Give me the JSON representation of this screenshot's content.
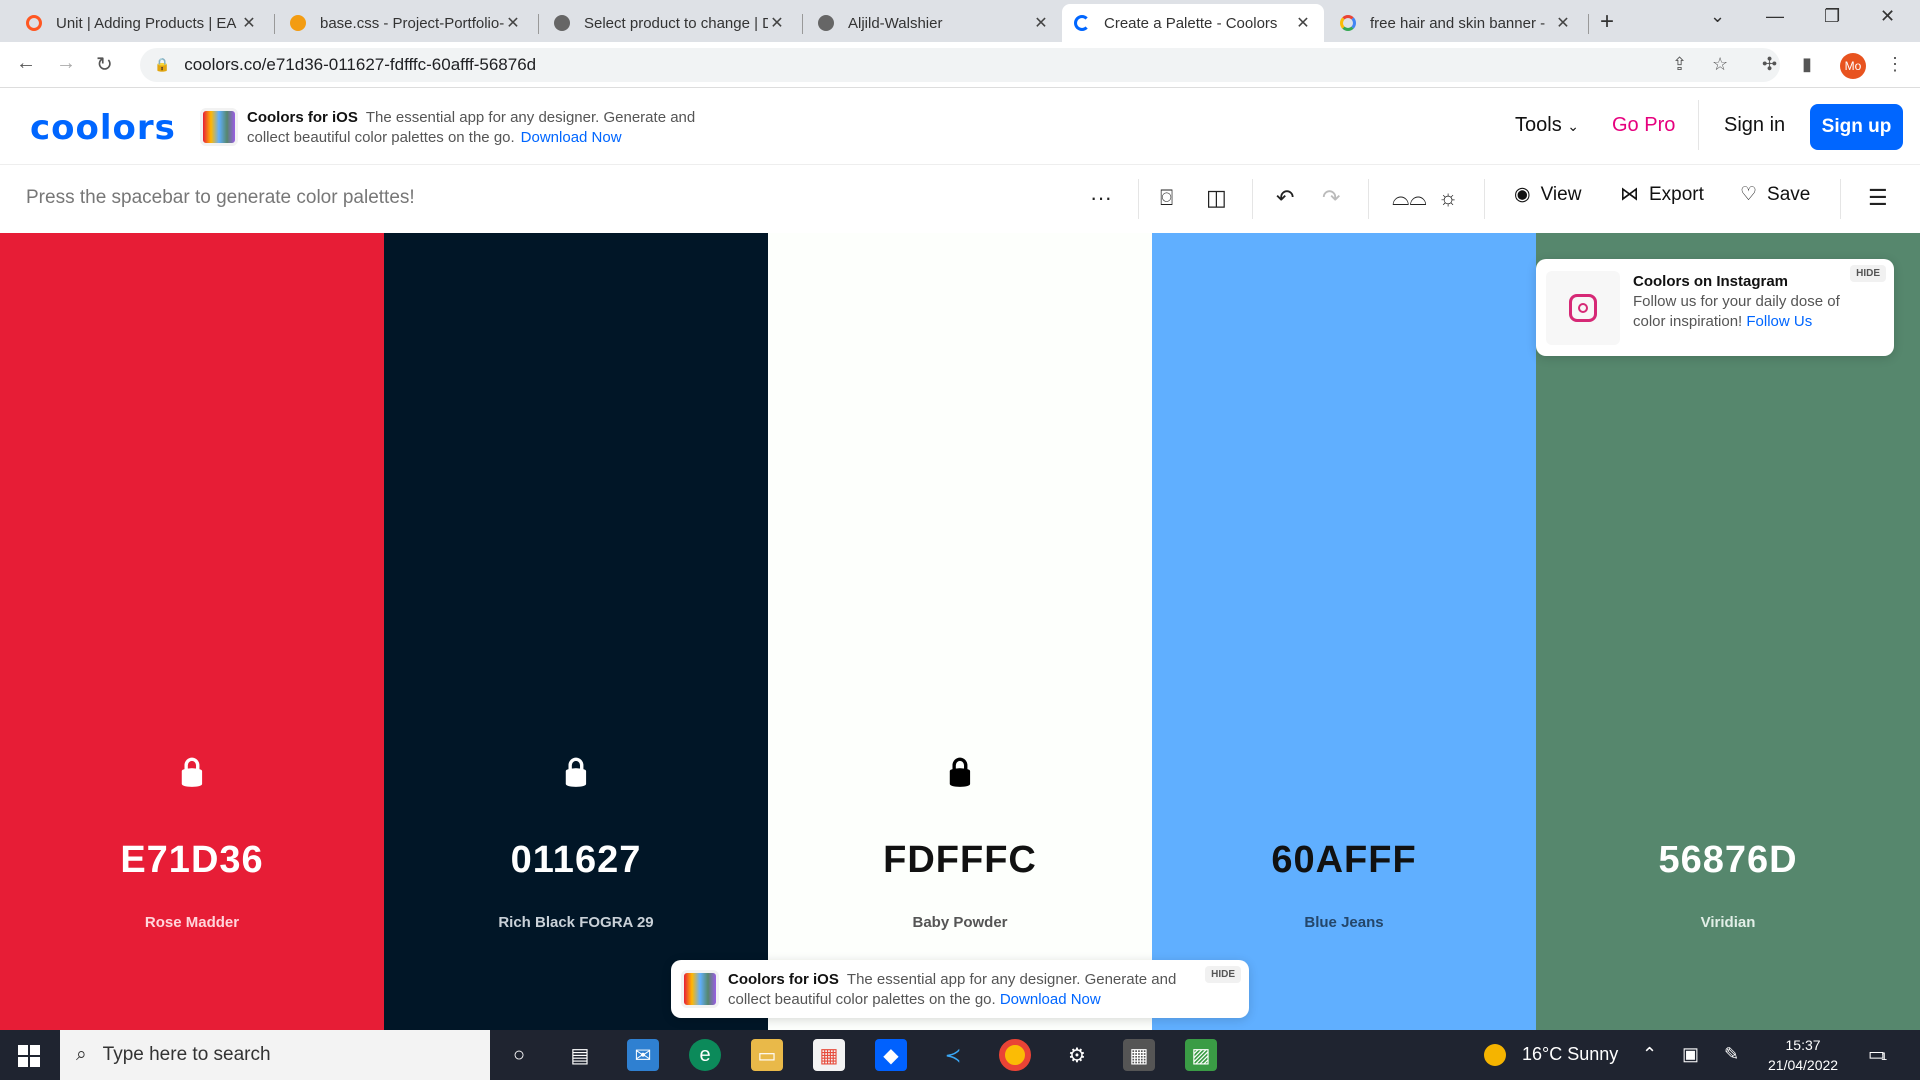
{
  "browser": {
    "tabs": [
      {
        "title": "Unit | Adding Products | EA",
        "favicon_color": "#ff5722"
      },
      {
        "title": "base.css - Project-Portfolio-",
        "favicon_color": "#f39c12"
      },
      {
        "title": "Select product to change | D",
        "favicon_color": "#666666"
      },
      {
        "title": "Aljild-Walshier",
        "favicon_color": "#666666"
      },
      {
        "title": "Create a Palette - Coolors",
        "favicon_color": "#0066ff"
      },
      {
        "title": "free hair and skin banner - ",
        "favicon_color": "#4285f4"
      }
    ],
    "url": "coolors.co/e71d36-011627-fdfffc-60afff-56876d",
    "profile_initials": "Mo"
  },
  "header": {
    "logo": "coolors",
    "promo_title": "Coolors for iOS",
    "promo_text": "The essential app for any designer. Generate and collect beautiful color palettes on the go.",
    "promo_link": "Download Now",
    "tools_label": "Tools",
    "gopro_label": "Go Pro",
    "signin_label": "Sign in",
    "signup_label": "Sign up"
  },
  "toolbar": {
    "hint": "Press the spacebar to generate color palettes!",
    "view_label": "View",
    "export_label": "Export",
    "save_label": "Save"
  },
  "palette": [
    {
      "hex": "E71D36",
      "name": "Rose Madder",
      "color": "#e71d36",
      "text_color": "#ffffff",
      "sub_color": "#ffd6dc",
      "lock_color": "#ffffff"
    },
    {
      "hex": "011627",
      "name": "Rich Black FOGRA 29",
      "color": "#011627",
      "text_color": "#ffffff",
      "sub_color": "#c9d1d8",
      "lock_color": "#ffffff"
    },
    {
      "hex": "FDFFFC",
      "name": "Baby Powder",
      "color": "#fdfffc",
      "text_color": "#111111",
      "sub_color": "#555555",
      "lock_color": "#000000"
    },
    {
      "hex": "60AFFF",
      "name": "Blue Jeans",
      "color": "#60afff",
      "text_color": "#111111",
      "sub_color": "#24466a",
      "lock_color": "#111111"
    },
    {
      "hex": "56876D",
      "name": "Viridian",
      "color": "#56876d",
      "text_color": "#ffffff",
      "sub_color": "#e2eee7",
      "lock_color": "#ffffff"
    }
  ],
  "instagram_popup": {
    "title": "Coolors on Instagram",
    "text": "Follow us for your daily dose of color inspiration!",
    "link": "Follow Us",
    "hide": "HIDE"
  },
  "ios_popup": {
    "title": "Coolors for iOS",
    "text": "The essential app for any designer. Generate and collect beautiful color palettes on the go.",
    "link": "Download Now",
    "hide": "HIDE"
  },
  "taskbar": {
    "search_placeholder": "Type here to search",
    "weather": "16°C  Sunny",
    "time": "15:37",
    "date": "21/04/2022",
    "notifications": "1"
  }
}
